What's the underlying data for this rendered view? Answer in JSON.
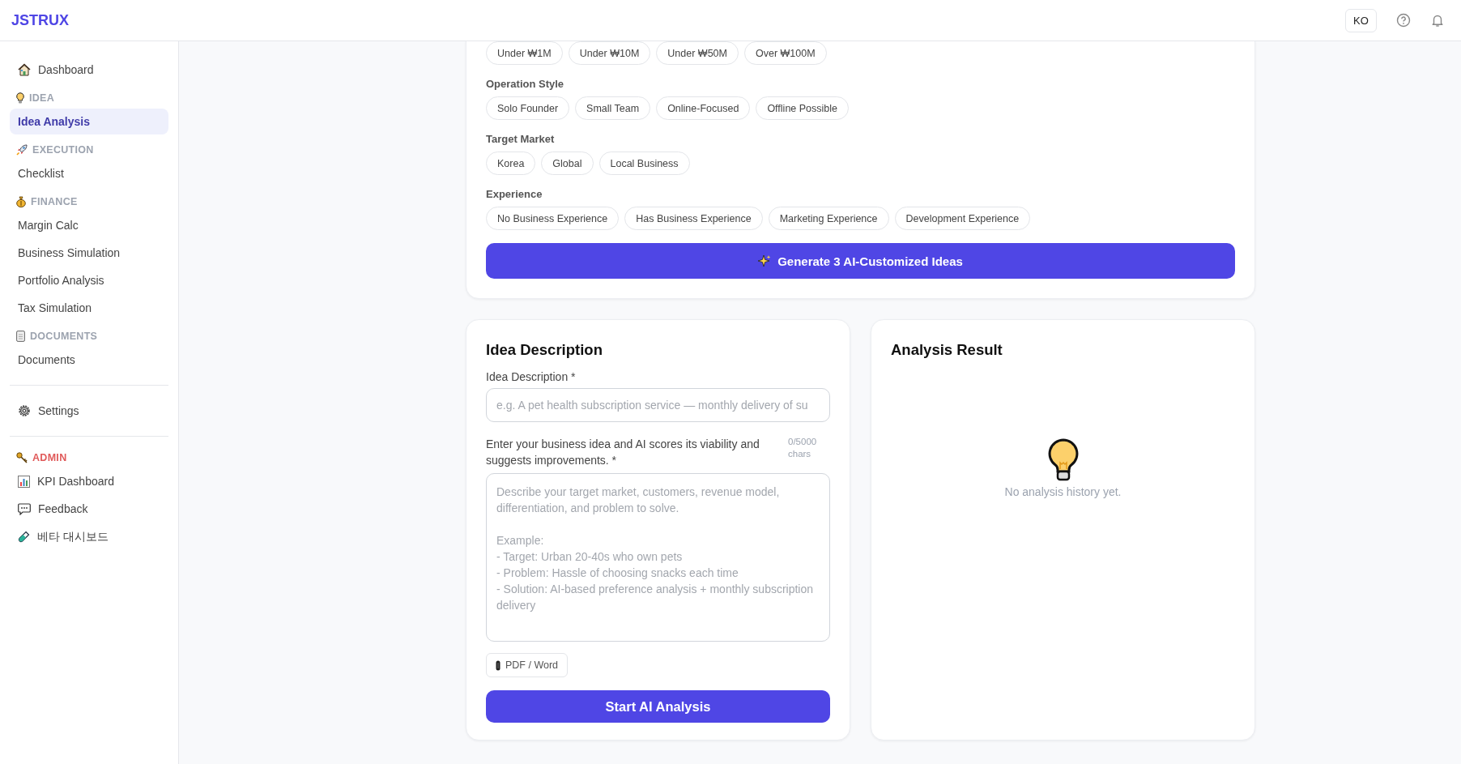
{
  "header": {
    "logo": "JSTRUX",
    "language_button": "KO"
  },
  "sidebar": {
    "groups": [
      {
        "items": [
          {
            "kind": "link",
            "label": "Dashboard",
            "selected": false
          },
          {
            "kind": "section",
            "label": "IDEA",
            "color": "#9ca3af"
          },
          {
            "kind": "link",
            "label": "Idea Analysis",
            "selected": true
          },
          {
            "kind": "section",
            "label": "EXECUTION",
            "color": "#9ca3af"
          },
          {
            "kind": "link",
            "label": "Checklist",
            "selected": false
          },
          {
            "kind": "section",
            "label": "FINANCE",
            "color": "#9ca3af"
          },
          {
            "kind": "link",
            "label": "Margin Calc",
            "selected": false
          },
          {
            "kind": "link",
            "label": "Business Simulation",
            "selected": false
          },
          {
            "kind": "link",
            "label": "Portfolio Analysis",
            "selected": false
          },
          {
            "kind": "link",
            "label": "Tax Simulation",
            "selected": false
          },
          {
            "kind": "section",
            "label": "DOCUMENTS",
            "color": "#9ca3af"
          },
          {
            "kind": "link",
            "label": "Documents",
            "selected": false
          }
        ]
      },
      {
        "items": [
          {
            "kind": "link",
            "label": "Settings",
            "selected": false
          }
        ]
      },
      {
        "items": [
          {
            "kind": "section",
            "label": "ADMIN",
            "color": "#e05a5a"
          },
          {
            "kind": "link",
            "label": "KPI Dashboard",
            "selected": false
          },
          {
            "kind": "link",
            "label": "Feedback",
            "selected": false
          },
          {
            "kind": "link",
            "label": "베타 대시보드",
            "selected": false
          }
        ]
      }
    ]
  },
  "filters": [
    {
      "chips": [
        {
          "label": "Under ₩1M",
          "selected": false
        },
        {
          "label": "Under ₩10M",
          "selected": false
        },
        {
          "label": "Under ₩50M",
          "selected": false
        },
        {
          "label": "Over ₩100M",
          "selected": false
        }
      ]
    },
    {
      "title": "Operation Style",
      "chips": [
        {
          "label": "Solo Founder",
          "selected": false
        },
        {
          "label": "Small Team",
          "selected": false
        },
        {
          "label": "Online-Focused",
          "selected": false
        },
        {
          "label": "Offline Possible",
          "selected": false
        }
      ]
    },
    {
      "title": "Target Market",
      "chips": [
        {
          "label": "Korea",
          "selected": false
        },
        {
          "label": "Global",
          "selected": false
        },
        {
          "label": "Local Business",
          "selected": false
        }
      ]
    },
    {
      "title": "Experience",
      "chips": [
        {
          "label": "No Business Experience",
          "selected": false
        },
        {
          "label": "Has Business Experience",
          "selected": false
        },
        {
          "label": "Marketing Experience",
          "selected": false
        },
        {
          "label": "Development Experience",
          "selected": false
        }
      ]
    }
  ],
  "generate_button": "Generate 3 AI-Customized Ideas",
  "idea_card": {
    "title": "Idea Description",
    "field_label": "Idea Description *",
    "field_placeholder": "e.g. A pet health subscription service — monthly delivery of su",
    "help_text": "Enter your business idea and AI scores its viability and suggests improvements. *",
    "counter": "0/5000 chars",
    "textarea_placeholder": "Describe your target market, customers, revenue model, differentiation, and problem to solve.\n\nExample:\n- Target: Urban 20-40s who own pets\n- Problem: Hassle of choosing snacks each time\n- Solution: AI-based preference analysis + monthly subscription delivery",
    "attach_button": "PDF / Word",
    "submit_button": "Start AI Analysis"
  },
  "result_card": {
    "title": "Analysis Result",
    "empty_text": "No analysis history yet."
  }
}
